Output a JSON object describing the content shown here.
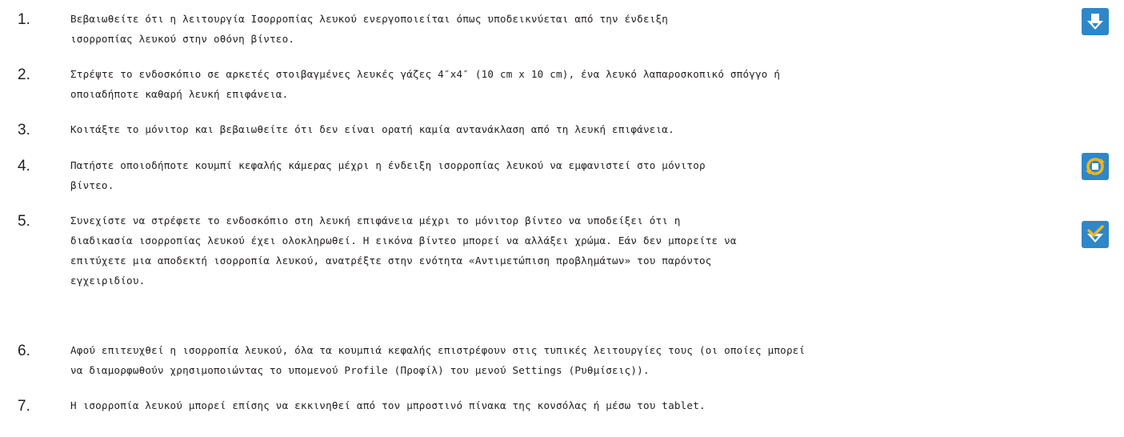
{
  "steps": [
    {
      "number": "1.",
      "lines": [
        "Βεβαιωθείτε ότι η λειτουργία Ισορροπίας λευκού ενεργοποιείται όπως υποδεικνύεται από την ένδειξη",
        "ισορροπίας λευκού στην οθόνη βίντεο."
      ],
      "icon": "white-balance-icon"
    },
    {
      "number": "2.",
      "lines": [
        "Στρέψτε το ενδοσκόπιο σε αρκετές στοιβαγμένες λευκές γάζες 4″x4″ (10 cm x 10 cm), ένα λευκό λαπαροσκοπικό σπόγγο ή",
        "οποιαδήποτε καθαρή λευκή επιφάνεια."
      ]
    },
    {
      "number": "3.",
      "lines": [
        "Κοιτάξτε το μόνιτορ και βεβαιωθείτε ότι δεν είναι ορατή καμία αντανάκλαση από τη λευκή επιφάνεια."
      ]
    },
    {
      "number": "4.",
      "lines": [
        "Πατήστε οποιοδήποτε κουμπί κεφαλής κάμερας μέχρι η ένδειξη ισορροπίας λευκού να εμφανιστεί στο μόνιτορ",
        "βίντεο."
      ],
      "icon": "white-balance-in-progress-icon"
    },
    {
      "number": "5.",
      "lines": [
        "Συνεχίστε να στρέφετε το ενδοσκόπιο στη λευκή επιφάνεια μέχρι το μόνιτορ βίντεο να υποδείξει ότι η",
        "διαδικασία ισορροπίας λευκού έχει ολοκληρωθεί. Η εικόνα βίντεο μπορεί να αλλάξει χρώμα. Εάν δεν μπορείτε να",
        "επιτύχετε μια αποδεκτή ισορροπία λευκού, ανατρέξτε στην ενότητα «Αντιμετώπιση προβλημάτων» του παρόντος",
        "εγχειριδίου."
      ],
      "icon": "white-balance-complete-icon"
    },
    {
      "number": "6.",
      "lines": [
        "Αφού επιτευχθεί η ισορροπία λευκού, όλα τα κουμπιά κεφαλής επιστρέφουν στις τυπικές λειτουργίες τους (οι οποίες μπορεί",
        "να διαμορφωθούν χρησιμοποιώντας το υπομενού Profile (Προφίλ) του μενού Settings (Ρυθμίσεις))."
      ]
    },
    {
      "number": "7.",
      "lines": [
        "Η ισορροπία λευκού μπορεί επίσης να εκκινηθεί από τον μπροστινό πίνακα της κονσόλας ή μέσω του tablet."
      ]
    }
  ],
  "colors": {
    "icon_bg": "#2e87c8",
    "icon_accent": "#f2b51c",
    "text": "#231f20"
  }
}
